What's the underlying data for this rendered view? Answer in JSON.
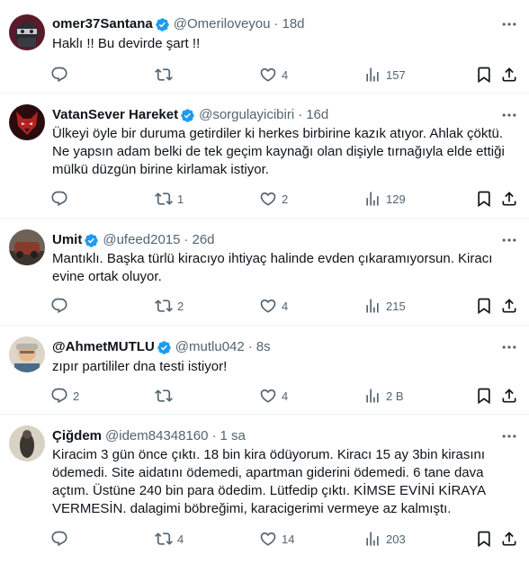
{
  "tweets": [
    {
      "name": "omer37Santana",
      "handle": "@Omeriloveyou",
      "time": "18d",
      "text": "Haklı !! Bu devirde şart !!",
      "replies": "",
      "retweets": "",
      "likes": "4",
      "views": "157"
    },
    {
      "name": "VatanSever Hareket",
      "handle": "@sorgulayicibiri",
      "time": "16d",
      "text": "Ülkeyi öyle bir duruma getirdiler ki herkes birbirine kazık atıyor. Ahlak çöktü.\nNe yapsın adam belki de tek geçim kaynağı olan dişiyle tırnağıyla elde ettiği\nmülkü düzgün birine kirlamak istiyor.",
      "replies": "",
      "retweets": "1",
      "likes": "2",
      "views": "129"
    },
    {
      "name": "Umit",
      "handle": "@ufeed2015",
      "time": "26d",
      "text": "Mantıklı. Başka türlü kiracıyo ihtiyaç halinde evden çıkaramıyorsun. Kiracı\nevine ortak oluyor.",
      "replies": "",
      "retweets": "2",
      "likes": "4",
      "views": "215"
    },
    {
      "name": "@AhmetMUTLU",
      "handle": "@mutlu042",
      "time": "8s",
      "text": "zıpır partililer dna testi istiyor!",
      "replies": "2",
      "retweets": "",
      "likes": "4",
      "views": "2 B"
    },
    {
      "name": "Çiğdem",
      "handle": "@idem84348160",
      "time": "1 sa",
      "text": "Kiracim 3 gün önce çıktı. 18 bin kira ödüyorum. Kiracı 15 ay 3bin kirasını\nödemedi. Site aidatını ödemedi, apartman giderini ödemedi. 6 tane dava\naçtım. Üstüne 240 bin para ödedim. Lütfedip çıktı. KİMSE EVİNİ KİRAYA\nVERMESİN.  dalagimi böbreğimi, karacigerimi vermeye az kalmıştı.",
      "replies": "",
      "retweets": "4",
      "likes": "14",
      "views": "203"
    }
  ],
  "separator": "·",
  "colors": {
    "verified": "#1d9bf0",
    "muted": "#536471",
    "text": "#0f1419",
    "border": "#eff3f4"
  },
  "icons": {
    "reply": "reply-icon",
    "retweet": "retweet-icon",
    "like": "heart-icon",
    "views": "views-icon",
    "bookmark": "bookmark-icon",
    "share": "share-icon",
    "more": "more-icon",
    "verified": "verified-badge-icon"
  }
}
